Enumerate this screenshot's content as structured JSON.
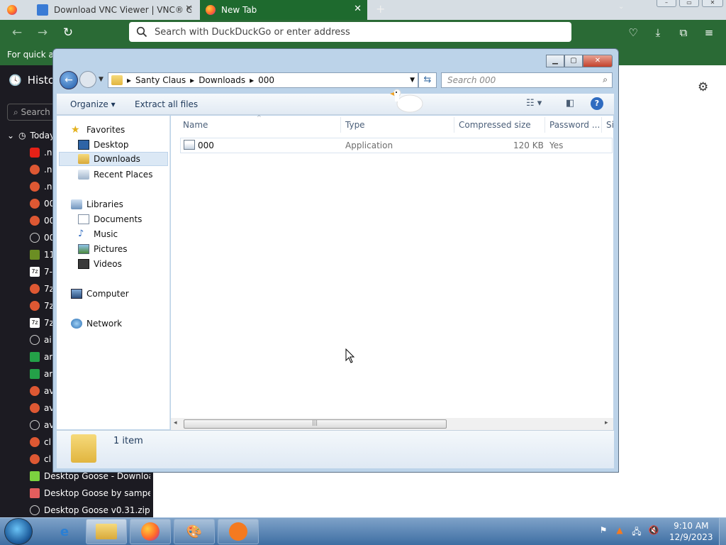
{
  "browser": {
    "tabs": [
      {
        "label": "Download VNC Viewer | VNC® C"
      },
      {
        "label": "New Tab"
      }
    ],
    "url_placeholder": "Search with DuckDuckGo or enter address",
    "bookmarks_text": "For quick ac"
  },
  "sidebar": {
    "title": "Histo",
    "search_placeholder": "Search",
    "today_label": "Today",
    "items": [
      {
        "icon": "youtube-icon",
        "label": ".n"
      },
      {
        "icon": "duckduckgo-icon",
        "label": ".n"
      },
      {
        "icon": "duckduckgo-icon",
        "label": ".n"
      },
      {
        "icon": "duckduckgo-icon",
        "label": "00"
      },
      {
        "icon": "duckduckgo-icon",
        "label": "00"
      },
      {
        "icon": "globe-icon",
        "label": "00"
      },
      {
        "icon": "site-icon",
        "label": "11"
      },
      {
        "icon": "7zip-icon",
        "label": "7-"
      },
      {
        "icon": "duckduckgo-icon",
        "label": "7z"
      },
      {
        "icon": "duckduckgo-icon",
        "label": "7z"
      },
      {
        "icon": "7zip-icon",
        "label": "7z"
      },
      {
        "icon": "globe-icon",
        "label": "ai"
      },
      {
        "icon": "archive-site-icon",
        "label": "ar"
      },
      {
        "icon": "archive-site-icon",
        "label": "ar"
      },
      {
        "icon": "duckduckgo-icon",
        "label": "av"
      },
      {
        "icon": "duckduckgo-icon",
        "label": "av"
      },
      {
        "icon": "globe-icon",
        "label": "av"
      },
      {
        "icon": "duckduckgo-icon",
        "label": "cl"
      },
      {
        "icon": "duckduckgo-icon",
        "label": "cl"
      },
      {
        "icon": "site-icon",
        "label": "Desktop Goose - Downloa"
      },
      {
        "icon": "site-icon",
        "label": "Desktop Goose by samper"
      },
      {
        "icon": "globe-icon",
        "label": "Desktop Goose v0.31.zip"
      }
    ]
  },
  "explorer": {
    "breadcrumb": [
      "Santy Claus",
      "Downloads",
      "000"
    ],
    "search_placeholder": "Search 000",
    "commands": {
      "organize": "Organize",
      "extract": "Extract all files"
    },
    "nav": {
      "favorites": "Favorites",
      "desktop": "Desktop",
      "downloads": "Downloads",
      "recent": "Recent Places",
      "libraries": "Libraries",
      "documents": "Documents",
      "music": "Music",
      "pictures": "Pictures",
      "videos": "Videos",
      "computer": "Computer",
      "network": "Network"
    },
    "columns": [
      "Name",
      "Type",
      "Compressed size",
      "Password ...",
      "Si"
    ],
    "files": [
      {
        "name": "000",
        "type": "Application",
        "size": "120 KB",
        "password": "Yes"
      }
    ],
    "status": "1 item"
  },
  "taskbar": {
    "time": "9:10 AM",
    "date": "12/9/2023"
  }
}
